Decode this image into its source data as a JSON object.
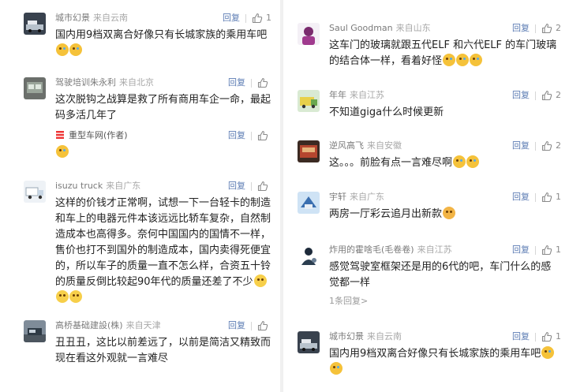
{
  "labels": {
    "reply": "回复"
  },
  "left": [
    {
      "user": "城市幻景",
      "loc": "来自云南",
      "likes": "1",
      "text": "国内用9档双离合好像只有长城家族的乘用车吧",
      "emojis": [
        "tears",
        "tears"
      ]
    },
    {
      "user": "驾驶培训朱永利",
      "loc": "来自北京",
      "likes": "",
      "text": "这次脱钩之战算是救了所有商用车企一命，最起码多活几年了",
      "emojis": [],
      "sub": {
        "user": "重型车网(作者)",
        "likes": "",
        "text": "",
        "emojis": [
          "tears"
        ]
      }
    },
    {
      "user": "isuzu truck",
      "loc": "来自广东",
      "likes": "",
      "text": "这样的价钱才正常啊，试想一下一台轻卡的制造和车上的电器元件本该远远比轿车复杂，自然制造成本也高得多。奈何中国国内的国情不一样，售价也打不到国外的制造成本，国内卖得死便宜的，所以车子的质量一直不怎么样，合资五十铃的质量反倒比较起90年代的质量还差了不少",
      "emojis": [
        "neutral",
        "neutral",
        "neutral"
      ]
    },
    {
      "user": "高桥基础建設(株)",
      "loc": "来自天津",
      "likes": "",
      "text": "丑丑丑，这比以前差远了，以前是简洁又精致而现在看这外观就一言难尽",
      "emojis": []
    }
  ],
  "right": [
    {
      "user": "Saul Goodman",
      "loc": "来自山东",
      "likes": "2",
      "text": "这车门的玻璃就跟五代ELF 和六代ELF 的车门玻璃的结合体一样，看着好怪",
      "emojis": [
        "tears",
        "tears",
        "tears"
      ]
    },
    {
      "user": "年年",
      "loc": "来自江苏",
      "likes": "2",
      "text": "不知道giga什么时候更新",
      "emojis": []
    },
    {
      "user": "逆风高飞",
      "loc": "来自安徽",
      "likes": "2",
      "text": "这。。。前脸有点一言难尽啊",
      "emojis": [
        "tears",
        "tears"
      ]
    },
    {
      "user": "宇轩",
      "loc": "来自广东",
      "likes": "1",
      "text": "两房一厅彩云追月出新款",
      "emojis": [
        "cat"
      ]
    },
    {
      "user": "炸用的霍啥毛(毛卷卷)",
      "loc": "来自江苏",
      "likes": "1",
      "text": "感觉驾驶室框架还是用的6代的吧，车门什么的感觉都一样",
      "emojis": [],
      "more": "1条回复>"
    },
    {
      "user": "城市幻景",
      "loc": "来自云南",
      "likes": "1",
      "text": "国内用9档双离合好像只有长城家族的乘用车吧",
      "emojis": [
        "tears",
        "tears"
      ]
    }
  ]
}
